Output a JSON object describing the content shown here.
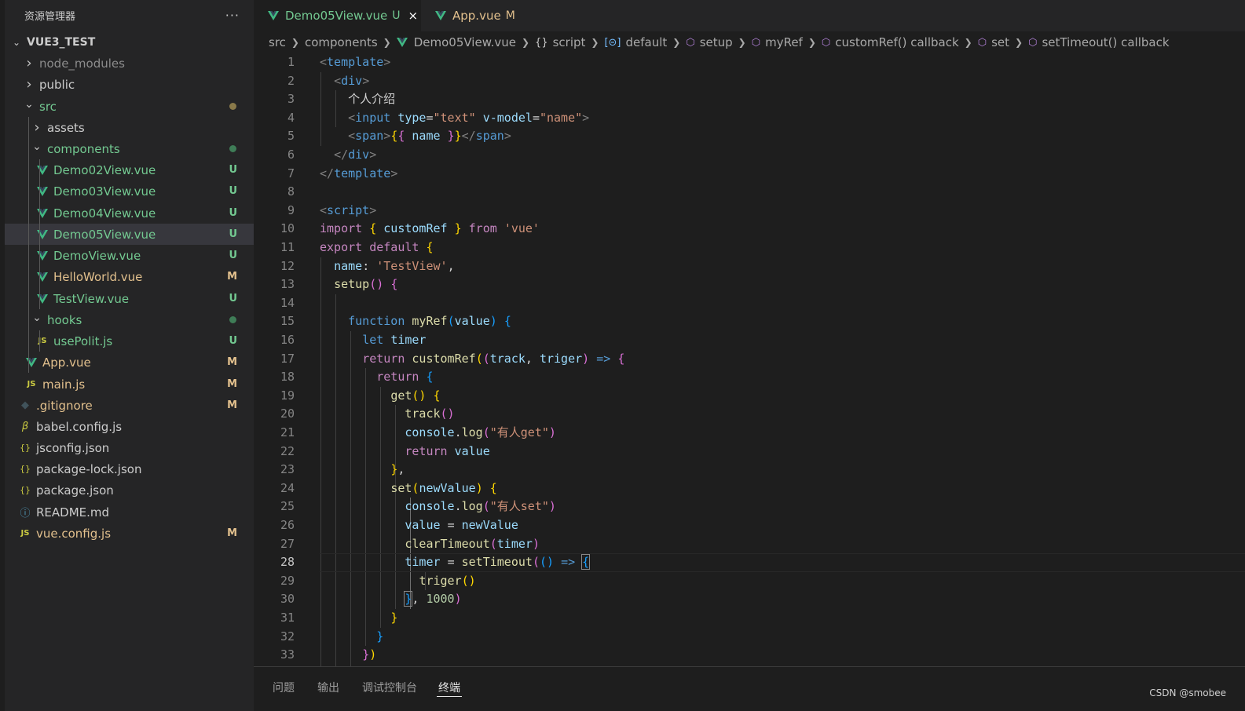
{
  "explorer": {
    "title": "资源管理器",
    "more": "···",
    "project": "VUE3_TEST",
    "items": [
      {
        "label": "node_modules",
        "badge": "",
        "color": "#8c8c8c"
      },
      {
        "label": "public",
        "badge": "",
        "color": "#cccccc"
      },
      {
        "label": "src",
        "badge": "",
        "color": "#73c991"
      },
      {
        "label": "assets",
        "badge": "",
        "color": "#cccccc"
      },
      {
        "label": "components",
        "badge": "",
        "color": "#73c991"
      },
      {
        "label": "Demo02View.vue",
        "badge": "U",
        "color": "#73c991"
      },
      {
        "label": "Demo03View.vue",
        "badge": "U",
        "color": "#73c991"
      },
      {
        "label": "Demo04View.vue",
        "badge": "U",
        "color": "#73c991"
      },
      {
        "label": "Demo05View.vue",
        "badge": "U",
        "color": "#73c991"
      },
      {
        "label": "DemoView.vue",
        "badge": "U",
        "color": "#73c991"
      },
      {
        "label": "HelloWorld.vue",
        "badge": "M",
        "color": "#e2c08d"
      },
      {
        "label": "TestView.vue",
        "badge": "U",
        "color": "#73c991"
      },
      {
        "label": "hooks",
        "badge": "",
        "color": "#73c991"
      },
      {
        "label": "usePolit.js",
        "badge": "U",
        "color": "#73c991"
      },
      {
        "label": "App.vue",
        "badge": "M",
        "color": "#e2c08d"
      },
      {
        "label": "main.js",
        "badge": "M",
        "color": "#e2c08d"
      },
      {
        "label": ".gitignore",
        "badge": "M",
        "color": "#e2c08d"
      },
      {
        "label": "babel.config.js",
        "badge": "",
        "color": "#cccccc"
      },
      {
        "label": "jsconfig.json",
        "badge": "",
        "color": "#cccccc"
      },
      {
        "label": "package-lock.json",
        "badge": "",
        "color": "#cccccc"
      },
      {
        "label": "package.json",
        "badge": "",
        "color": "#cccccc"
      },
      {
        "label": "README.md",
        "badge": "",
        "color": "#cccccc"
      },
      {
        "label": "vue.config.js",
        "badge": "M",
        "color": "#e2c08d"
      }
    ],
    "js_icon": "JS",
    "json_icon": "{}"
  },
  "tabs": [
    {
      "label": "Demo05View.vue",
      "badge": "U",
      "color": "#73c991",
      "close": "×"
    },
    {
      "label": "App.vue",
      "badge": "M",
      "color": "#e2c08d"
    }
  ],
  "breadcrumbs": [
    "src",
    "components",
    "Demo05View.vue",
    "script",
    "default",
    "setup",
    "myRef",
    "customRef() callback",
    "set",
    "setTimeout() callback"
  ],
  "editor": {
    "current_line": 28,
    "line_numbers": [
      "1",
      "2",
      "3",
      "4",
      "5",
      "6",
      "7",
      "8",
      "9",
      "10",
      "11",
      "12",
      "13",
      "14",
      "15",
      "16",
      "17",
      "18",
      "19",
      "20",
      "21",
      "22",
      "23",
      "24",
      "25",
      "26",
      "27",
      "28",
      "29",
      "30",
      "31",
      "32",
      "33"
    ],
    "code": {
      "l3_text": "个人介绍",
      "l4_type": "\"text\"",
      "l4_vmodel": "\"name\"",
      "l10_module": "'vue'",
      "l12_name": "'TestView'",
      "l21_str": "\"有人get\"",
      "l25_str": "\"有人set\"",
      "l30_delay": "1000"
    }
  },
  "panel": {
    "tabs": [
      "问题",
      "输出",
      "调试控制台",
      "终端"
    ],
    "active": "终端"
  },
  "watermark": "CSDN @smobee",
  "colors": {
    "untracked": "#73c991",
    "modified": "#e2c08d",
    "vue_green": "#41b883",
    "js_yellow": "#cbcb41",
    "selection": "#37373d"
  }
}
